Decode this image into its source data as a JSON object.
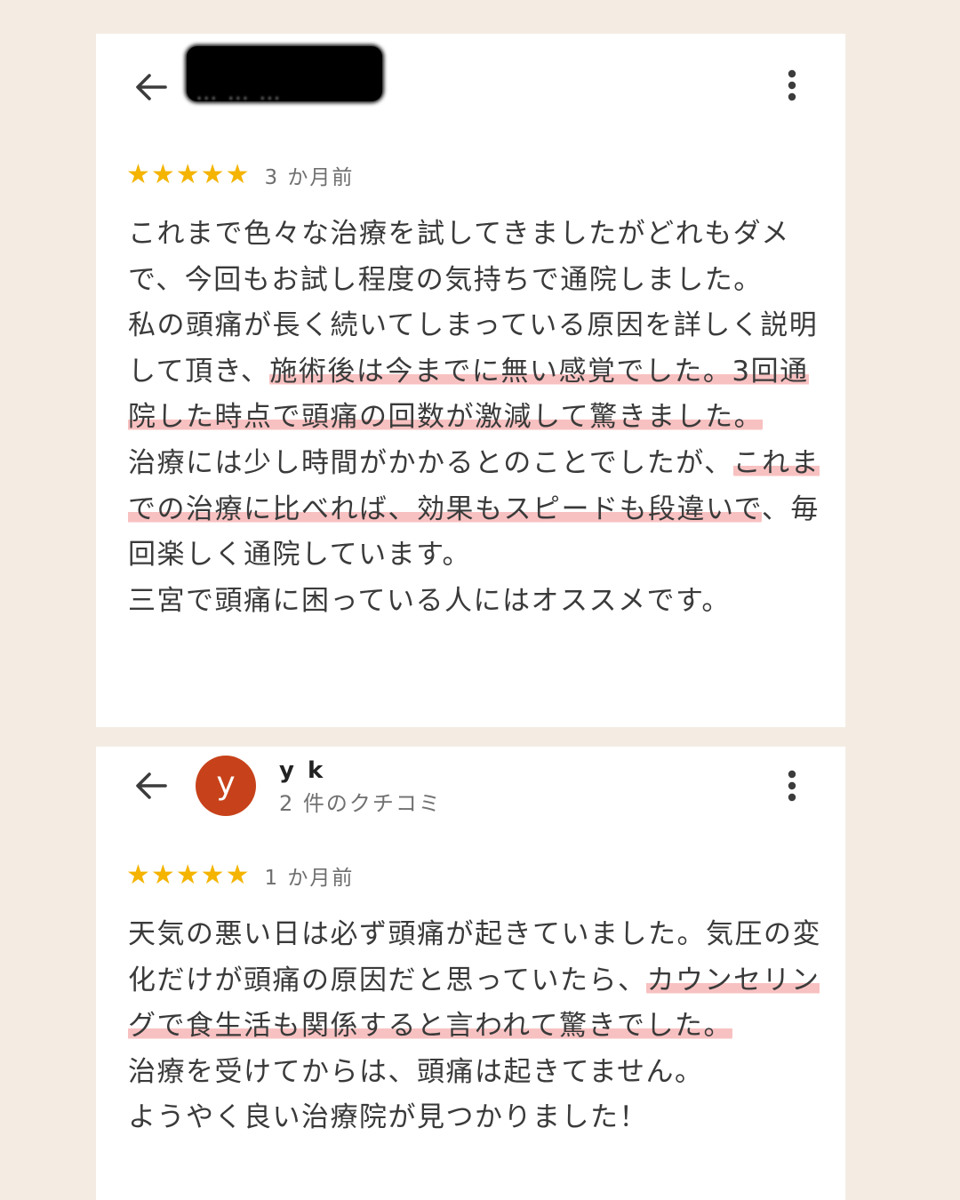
{
  "colors": {
    "background": "#f4ece3",
    "card": "#ffffff",
    "star": "#f4b400",
    "avatar": "#c7421a",
    "highlight": "#f5a0a0"
  },
  "reviews": [
    {
      "reviewer_name": "",
      "reviewer_name_redacted": true,
      "review_count_visible": "",
      "rating": 5,
      "stars": "★★★★★",
      "date": "3 か月前",
      "text_parts": [
        {
          "text": "これまで色々な治療を試してきましたがどれもダメで、今回もお試し程度の気持ちで通院しました。\n私の頭痛が長く続いてしまっている原因を詳しく説明して頂き、"
        },
        {
          "text": "施術後は今までに無い感覚でした。3回通院した時点で頭痛の回数が激減して驚きました。",
          "highlight": true
        },
        {
          "text": "\n治療には少し時間がかかるとのことでしたが、"
        },
        {
          "text": "これまでの治療に比べれば、効果もスピードも段違いで",
          "highlight": true
        },
        {
          "text": "、毎回楽しく通院しています。\n三宮で頭痛に困っている人にはオススメです。"
        }
      ]
    },
    {
      "reviewer_name": "y k",
      "avatar_letter": "y",
      "review_count": "2 件のクチコミ",
      "rating": 5,
      "stars": "★★★★★",
      "date": "1 か月前",
      "text_parts": [
        {
          "text": "天気の悪い日は必ず頭痛が起きていました。気圧の変化だけが頭痛の原因だと思っていたら、"
        },
        {
          "text": "カウンセリングで食生活も関係すると言われて驚きでした。",
          "highlight": true
        },
        {
          "text": "\n治療を受けてからは、頭痛は起きてません。\nようやく良い治療院が見つかりました！"
        }
      ]
    }
  ],
  "icons": {
    "back": "arrow-back-icon",
    "more": "more-vertical-icon"
  }
}
